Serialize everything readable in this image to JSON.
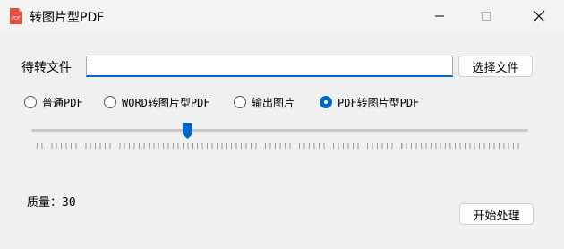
{
  "window": {
    "title": "转图片型PDF",
    "icon_badge": "PDF"
  },
  "file_row": {
    "label": "待转文件",
    "value": "",
    "choose_button": "选择文件"
  },
  "modes": [
    {
      "label": "普通PDF",
      "checked": false
    },
    {
      "label": "WORD转图片型PDF",
      "checked": false
    },
    {
      "label": "输出图片",
      "checked": false
    },
    {
      "label": "PDF转图片型PDF",
      "checked": true
    }
  ],
  "quality": {
    "label": "质量：",
    "value": "30",
    "slider_fraction": 0.3
  },
  "start_button": "开始处理",
  "colors": {
    "accent": "#0067c0",
    "icon_red": "#e74c3c"
  }
}
